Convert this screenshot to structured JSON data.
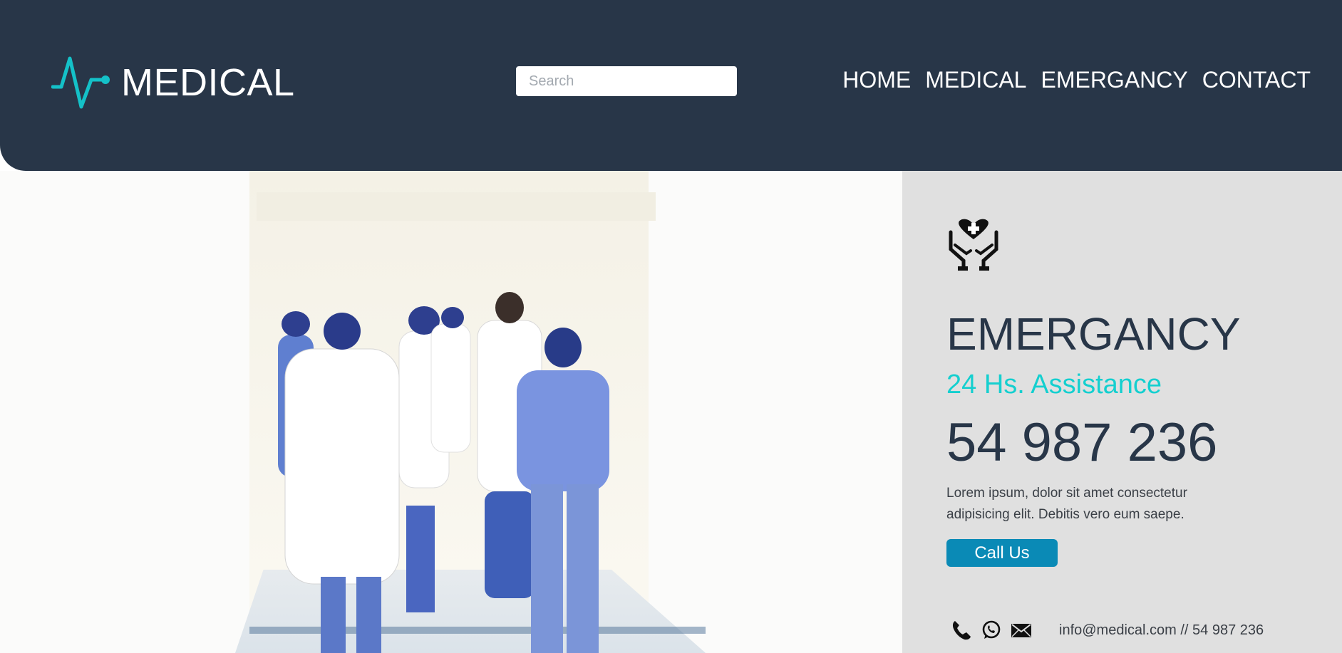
{
  "brand": {
    "name": "MEDICAL",
    "icon": "heartbeat-icon",
    "accent": "#14c1c8"
  },
  "header": {
    "background": "#283648"
  },
  "search": {
    "placeholder": "Search",
    "value": ""
  },
  "nav": {
    "items": [
      {
        "label": "HOME"
      },
      {
        "label": "MEDICAL"
      },
      {
        "label": "EMERGANCY"
      },
      {
        "label": "CONTACT"
      }
    ]
  },
  "emergency": {
    "icon": "care-hands-heart-icon",
    "title": "EMERGANCY",
    "subtitle": "24 Hs. Assistance",
    "phone": "54 987 236",
    "description": "Lorem ipsum, dolor sit amet consectetur adipisicing elit. Debitis vero eum saepe.",
    "call_label": "Call Us",
    "contact_icons": [
      "phone-icon",
      "whatsapp-icon",
      "mail-icon"
    ],
    "contact_text": "info@medical.com // 54 987 236"
  },
  "colors": {
    "accent_cyan": "#14cfcf",
    "button_blue": "#0a8ab6",
    "aside_bg": "#e0e0e0"
  }
}
